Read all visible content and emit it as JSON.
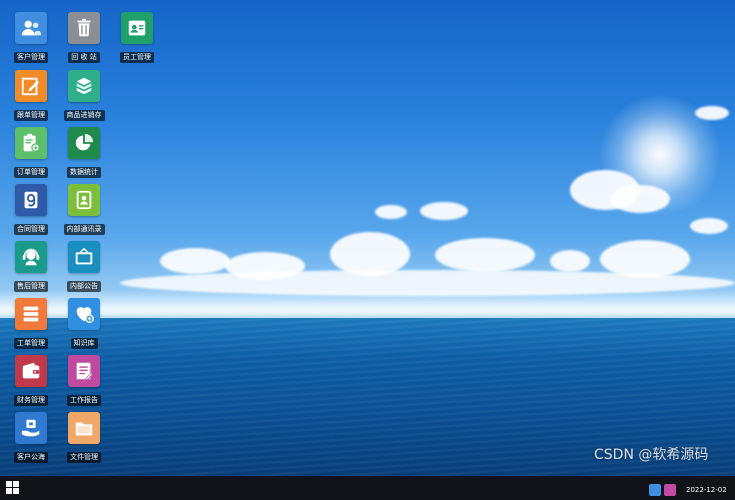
{
  "desktop_icons": [
    {
      "label": "客户管理",
      "icon": "users-icon",
      "color": "#3f8ee0"
    },
    {
      "label": "回 收 站",
      "icon": "trash-icon",
      "color": "#8a8f96"
    },
    {
      "label": "员工管理",
      "icon": "staff-card-icon",
      "color": "#1ea06a"
    },
    {
      "label": "跟单管理",
      "icon": "edit-icon",
      "color": "#f28c28"
    },
    {
      "label": "商品进销存",
      "icon": "boxes-icon",
      "color": "#2fae8a"
    },
    {
      "label": "订单管理",
      "icon": "clipboard-gear-icon",
      "color": "#5cc06a"
    },
    {
      "label": "数据统计",
      "icon": "pie-chart-icon",
      "color": "#1f8a4c"
    },
    {
      "label": "合同管理",
      "icon": "contract-icon",
      "color": "#2f5aa8"
    },
    {
      "label": "内部通讯录",
      "icon": "address-book-icon",
      "color": "#7cbf3c"
    },
    {
      "label": "售后管理",
      "icon": "headset-icon",
      "color": "#1a9a8a"
    },
    {
      "label": "内部公告",
      "icon": "notice-board-icon",
      "color": "#1a8fbf"
    },
    {
      "label": "工单管理",
      "icon": "list-icon",
      "color": "#f07a3c"
    },
    {
      "label": "知识库",
      "icon": "heart-plus-icon",
      "color": "#2f8fe0"
    },
    {
      "label": "财务管理",
      "icon": "wallet-icon",
      "color": "#c0394a"
    },
    {
      "label": "工作报告",
      "icon": "report-icon",
      "color": "#c04aa0"
    },
    {
      "label": "客户公海",
      "icon": "hand-box-icon",
      "color": "#2f7ad0"
    },
    {
      "label": "文件管理",
      "icon": "folder-icon",
      "color": "#f0a868"
    }
  ],
  "taskbar": {
    "clock_date": "2022-12-02"
  },
  "watermark": "CSDN @软希源码"
}
